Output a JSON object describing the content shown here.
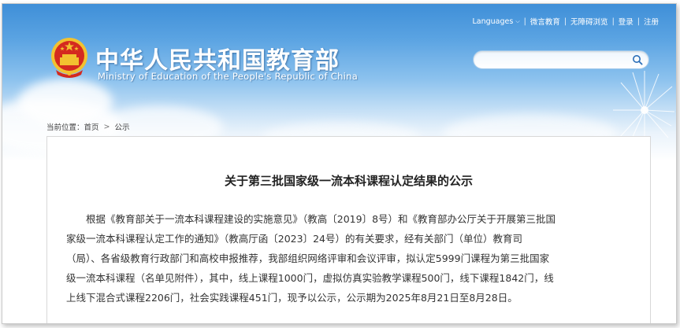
{
  "topbar": {
    "languages": "Languages",
    "weibo": "微言教育",
    "accessibility": "无障碍浏览",
    "login": "登录",
    "register": "注册"
  },
  "site": {
    "title": "中华人民共和国教育部",
    "subtitle": "Ministry of Education of the People's Republic of China"
  },
  "search": {
    "value": "",
    "placeholder": ""
  },
  "breadcrumb": {
    "label": "当前位置：",
    "home": "首页",
    "arrow": ">",
    "current": "公示"
  },
  "article": {
    "title": "关于第三批国家级一流本科课程认定结果的公示",
    "lines": [
      "　　根据《教育部关于一流本科课程建设的实施意见》（教高〔2019〕8号）和《教育部办公厅关于开展第三批国",
      "家级一流本科课程认定工作的通知》（教高厅函〔2023〕24号）的有关要求，经有关部门（单位）教育司",
      "（局）、各省级教育行政部门和高校申报推荐，我部组织网络评审和会议评审，拟认定5999门课程为第三批国家",
      "级一流本科课程（名单见附件），其中，线上课程1000门，虚拟仿真实验教学课程500门，线下课程1842门，线",
      "上线下混合式课程2206门，社会实践课程451门，现予以公示，公示期为2025年8月21日至8月28日。"
    ]
  },
  "colors": {
    "header_top": "#3f8fd8",
    "emblem_red": "#d42a1f",
    "emblem_gold": "#f2c230"
  }
}
